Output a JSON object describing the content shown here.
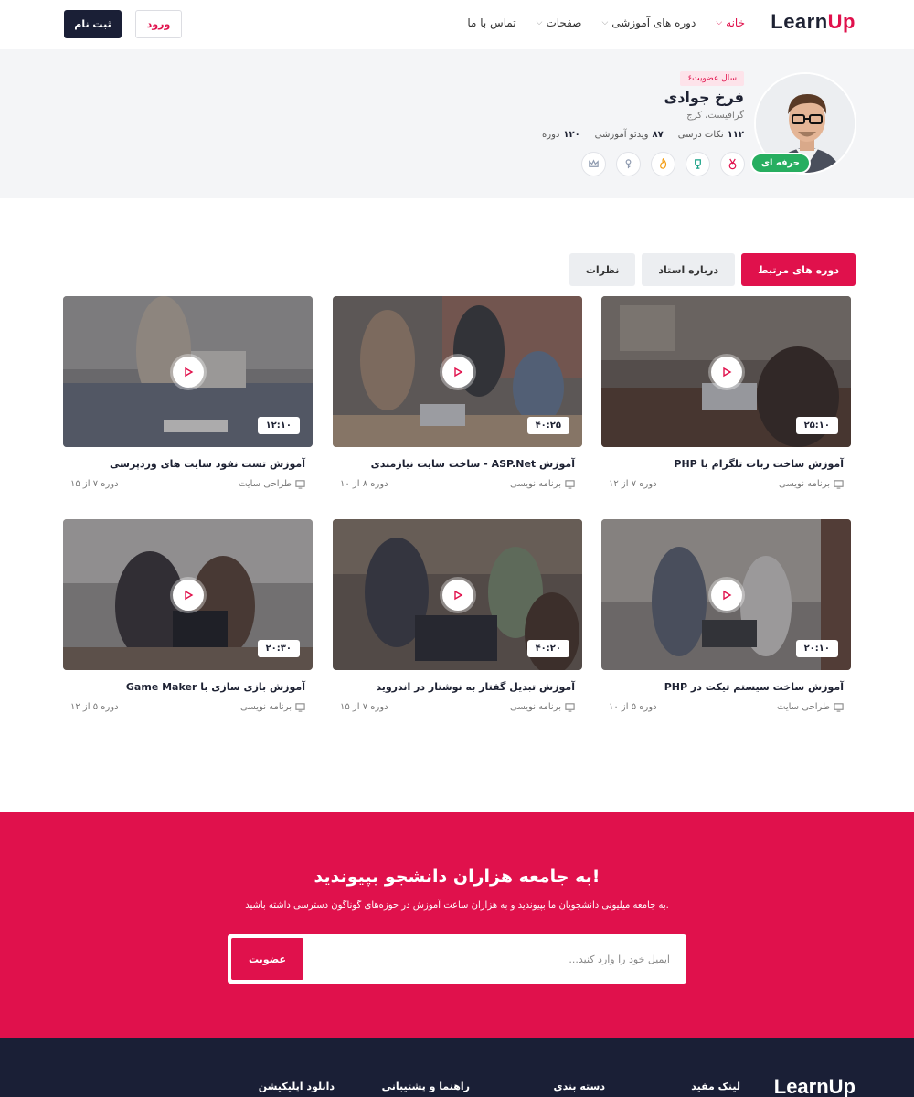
{
  "header": {
    "logo_main": "Learn",
    "logo_accent": "Up",
    "nav": [
      {
        "label": "خانه",
        "has_dropdown": true,
        "active": true
      },
      {
        "label": "دوره های آموزشی",
        "has_dropdown": true,
        "active": false
      },
      {
        "label": "صفحات",
        "has_dropdown": true,
        "active": false
      },
      {
        "label": "تماس با ما",
        "has_dropdown": false,
        "active": false
      }
    ],
    "login_label": "ورود",
    "register_label": "ثبت نام"
  },
  "profile": {
    "membership": "۶سال عضویت",
    "name": "فرخ جوادی",
    "location": "گرافیست، کرج",
    "level_badge": "حرفه ای",
    "stats": [
      {
        "value": "۱۱۲",
        "label": "نکات درسی"
      },
      {
        "value": "۸۷",
        "label": "ویدئو آموزشی"
      },
      {
        "value": "۱۲۰",
        "label": "دوره"
      }
    ],
    "awards": [
      "medal-icon",
      "trophy-icon",
      "fire-icon",
      "key-icon",
      "crown-icon"
    ]
  },
  "tabs": [
    {
      "label": "دوره های مرتبط",
      "active": true
    },
    {
      "label": "درباره استاد",
      "active": false
    },
    {
      "label": "نظرات",
      "active": false
    }
  ],
  "courses": [
    {
      "title": "آموزش ساخت ربات تلگرام با PHP",
      "duration": "۲۵:۱۰",
      "progress": "دوره ۷ از ۱۲",
      "category": "برنامه نویسی"
    },
    {
      "title": "آموزش ASP.Net - ساخت سایت نیازمندی",
      "duration": "۴۰:۲۵",
      "progress": "دوره ۸ از ۱۰",
      "category": "برنامه نویسی"
    },
    {
      "title": "آموزش تست نفوذ سایت های وردپرسی",
      "duration": "۱۲:۱۰",
      "progress": "دوره ۷ از ۱۵",
      "category": "طراحی سایت"
    },
    {
      "title": "آموزش ساخت سیستم تیکت در PHP",
      "duration": "۲۰:۱۰",
      "progress": "دوره ۵ از ۱۰",
      "category": "طراحی سایت"
    },
    {
      "title": "آموزش تبدیل گفتار به نوشتار در اندروید",
      "duration": "۴۰:۲۰",
      "progress": "دوره ۷ از ۱۵",
      "category": "برنامه نویسی"
    },
    {
      "title": "آموزش بازی سازی با Game Maker",
      "duration": "۲۰:۳۰",
      "progress": "دوره ۵ از ۱۲",
      "category": "برنامه نویسی"
    }
  ],
  "cta": {
    "title": "به جامعه هزاران دانشجو بپیوندید!",
    "subtitle": "به جامعه میلیونی دانشجویان ما بپیوندید و به هزاران ساعت آموزش در حوزه‌های گوناگون دسترسی داشته باشید.",
    "email_placeholder": "ایمیل خود را وارد کنید...",
    "button_label": "عضویت"
  },
  "footer": {
    "logo": "LearnUp",
    "columns": [
      "لینک مفید",
      "دسته بندی",
      "راهنما و پشتیبانی",
      "دانلود اپلیکیشن"
    ]
  },
  "colors": {
    "accent": "#e0114c",
    "navy": "#1a1f36",
    "success": "#27ae60",
    "band": "#f4f5f7"
  }
}
